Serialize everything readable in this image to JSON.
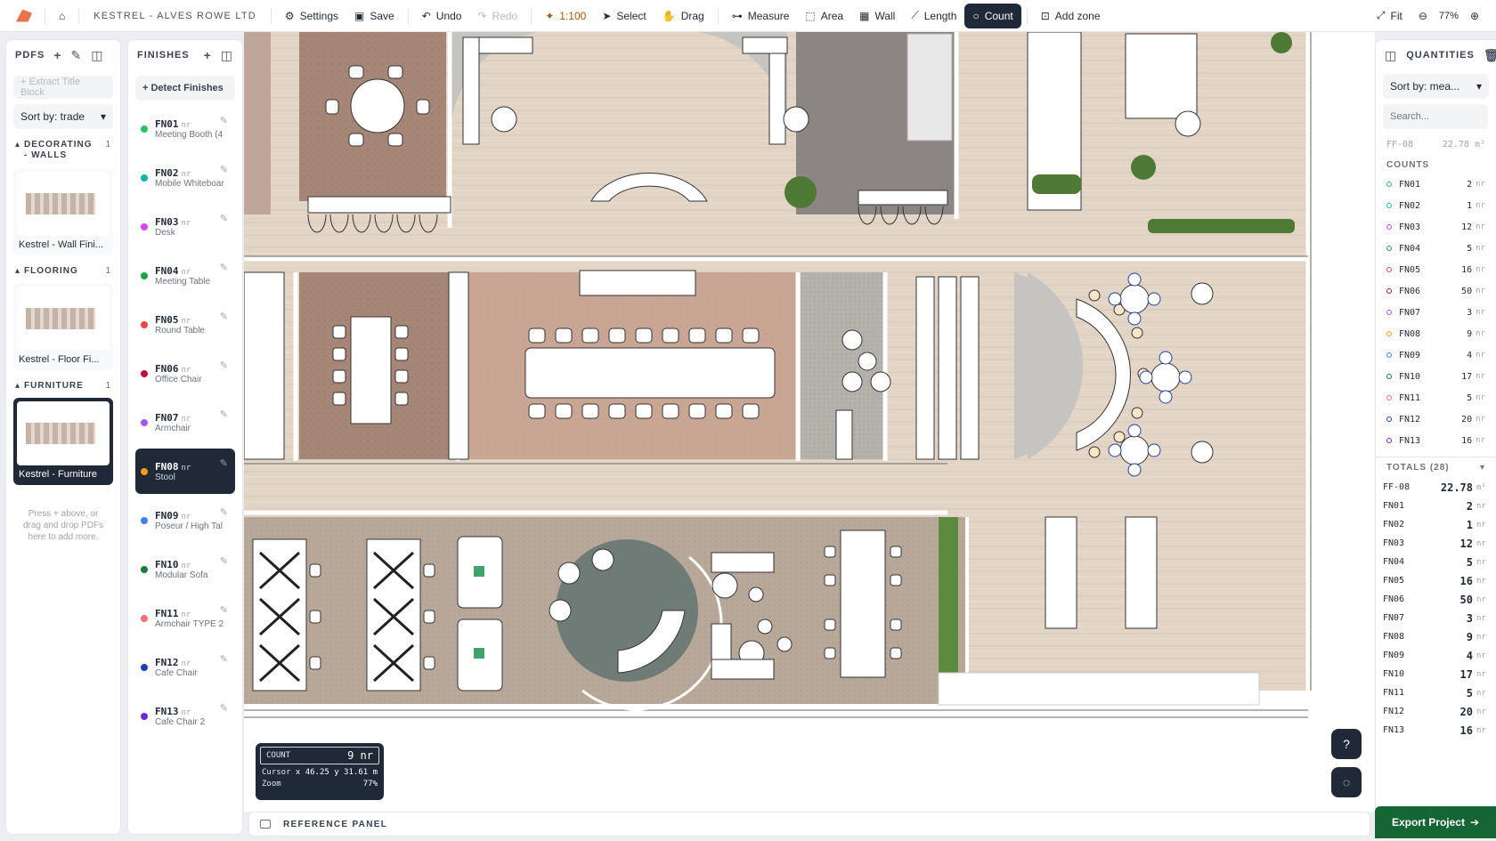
{
  "toolbar": {
    "project": "KESTREL - ALVES ROWE LTD",
    "settings": "Settings",
    "save": "Save",
    "undo": "Undo",
    "redo": "Redo",
    "scale": "1:100",
    "select": "Select",
    "drag": "Drag",
    "measure": "Measure",
    "area": "Area",
    "wall": "Wall",
    "length": "Length",
    "count": "Count",
    "add_zone": "Add zone",
    "fit": "Fit",
    "zoom": "77%"
  },
  "pdfs": {
    "title": "PDFS",
    "extract": "+ Extract Title Block",
    "sort": "Sort by: trade",
    "groups": [
      {
        "name": "DECORATING - WALLS",
        "count": "1",
        "file": "Kestrel - Wall Fini..."
      },
      {
        "name": "FLOORING",
        "count": "1",
        "file": "Kestrel - Floor Fi..."
      },
      {
        "name": "FURNITURE",
        "count": "1",
        "file": "Kestrel - Furniture"
      }
    ],
    "hint": "Press + above, or drag and drop PDFs here to add more."
  },
  "finishes": {
    "title": "FINISHES",
    "detect": "+ Detect Finishes",
    "items": [
      {
        "code": "FN01",
        "unit": "nr",
        "desc": "Meeting Booth (4",
        "color": "#22c55e"
      },
      {
        "code": "FN02",
        "unit": "nr",
        "desc": "Mobile Whiteboar",
        "color": "#14b8a6"
      },
      {
        "code": "FN03",
        "unit": "nr",
        "desc": "Desk",
        "color": "#d946ef"
      },
      {
        "code": "FN04",
        "unit": "nr",
        "desc": "Meeting Table",
        "color": "#16a34a"
      },
      {
        "code": "FN05",
        "unit": "nr",
        "desc": "Round Table",
        "color": "#ef4444"
      },
      {
        "code": "FN06",
        "unit": "nr",
        "desc": "Office Chair",
        "color": "#be123c"
      },
      {
        "code": "FN07",
        "unit": "nr",
        "desc": "Armchair",
        "color": "#a855f7"
      },
      {
        "code": "FN08",
        "unit": "nr",
        "desc": "Stool",
        "color": "#f59e0b"
      },
      {
        "code": "FN09",
        "unit": "nr",
        "desc": "Poseur / High Tal",
        "color": "#3b82f6"
      },
      {
        "code": "FN10",
        "unit": "nr",
        "desc": "Modular Sofa",
        "color": "#15803d"
      },
      {
        "code": "FN11",
        "unit": "nr",
        "desc": "Armchair TYPE 2",
        "color": "#f87171"
      },
      {
        "code": "FN12",
        "unit": "nr",
        "desc": "Cafe Chair",
        "color": "#1e40af"
      },
      {
        "code": "FN13",
        "unit": "nr",
        "desc": "Cafe Chair 2",
        "color": "#6d28d9"
      }
    ]
  },
  "overlay": {
    "count_label": "COUNT",
    "count_value": "9 nr",
    "cursor_label": "Cursor",
    "cursor_value": "x 46.25 y 31.61 m",
    "zoom_label": "Zoom",
    "zoom_value": "77%"
  },
  "reference_panel": "REFERENCE PANEL",
  "quantities": {
    "title": "QUANTITIES",
    "sort": "Sort by: mea...",
    "search_placeholder": "Search...",
    "ff_code": "FF-08",
    "ff_value": "22.78 m²",
    "counts_label": "COUNTS",
    "counts": [
      {
        "code": "FN01",
        "value": "2",
        "unit": "nr",
        "color": "#22c55e"
      },
      {
        "code": "FN02",
        "value": "1",
        "unit": "nr",
        "color": "#14b8a6"
      },
      {
        "code": "FN03",
        "value": "12",
        "unit": "nr",
        "color": "#d946ef"
      },
      {
        "code": "FN04",
        "value": "5",
        "unit": "nr",
        "color": "#16a34a"
      },
      {
        "code": "FN05",
        "value": "16",
        "unit": "nr",
        "color": "#ef4444"
      },
      {
        "code": "FN06",
        "value": "50",
        "unit": "nr",
        "color": "#be123c"
      },
      {
        "code": "FN07",
        "value": "3",
        "unit": "nr",
        "color": "#a855f7"
      },
      {
        "code": "FN08",
        "value": "9",
        "unit": "nr",
        "color": "#f59e0b"
      },
      {
        "code": "FN09",
        "value": "4",
        "unit": "nr",
        "color": "#3b82f6"
      },
      {
        "code": "FN10",
        "value": "17",
        "unit": "nr",
        "color": "#15803d"
      },
      {
        "code": "FN11",
        "value": "5",
        "unit": "nr",
        "color": "#f87171"
      },
      {
        "code": "FN12",
        "value": "20",
        "unit": "nr",
        "color": "#1e40af"
      },
      {
        "code": "FN13",
        "value": "16",
        "unit": "nr",
        "color": "#6d28d9"
      }
    ],
    "totals_label": "TOTALS (28)",
    "totals": [
      {
        "code": "FF-08",
        "value": "22.78",
        "unit": "m²"
      },
      {
        "code": "FN01",
        "value": "2",
        "unit": "nr"
      },
      {
        "code": "FN02",
        "value": "1",
        "unit": "nr"
      },
      {
        "code": "FN03",
        "value": "12",
        "unit": "nr"
      },
      {
        "code": "FN04",
        "value": "5",
        "unit": "nr"
      },
      {
        "code": "FN05",
        "value": "16",
        "unit": "nr"
      },
      {
        "code": "FN06",
        "value": "50",
        "unit": "nr"
      },
      {
        "code": "FN07",
        "value": "3",
        "unit": "nr"
      },
      {
        "code": "FN08",
        "value": "9",
        "unit": "nr"
      },
      {
        "code": "FN09",
        "value": "4",
        "unit": "nr"
      },
      {
        "code": "FN10",
        "value": "17",
        "unit": "nr"
      },
      {
        "code": "FN11",
        "value": "5",
        "unit": "nr"
      },
      {
        "code": "FN12",
        "value": "20",
        "unit": "nr"
      },
      {
        "code": "FN13",
        "value": "16",
        "unit": "nr"
      }
    ],
    "export": "Export Project"
  }
}
